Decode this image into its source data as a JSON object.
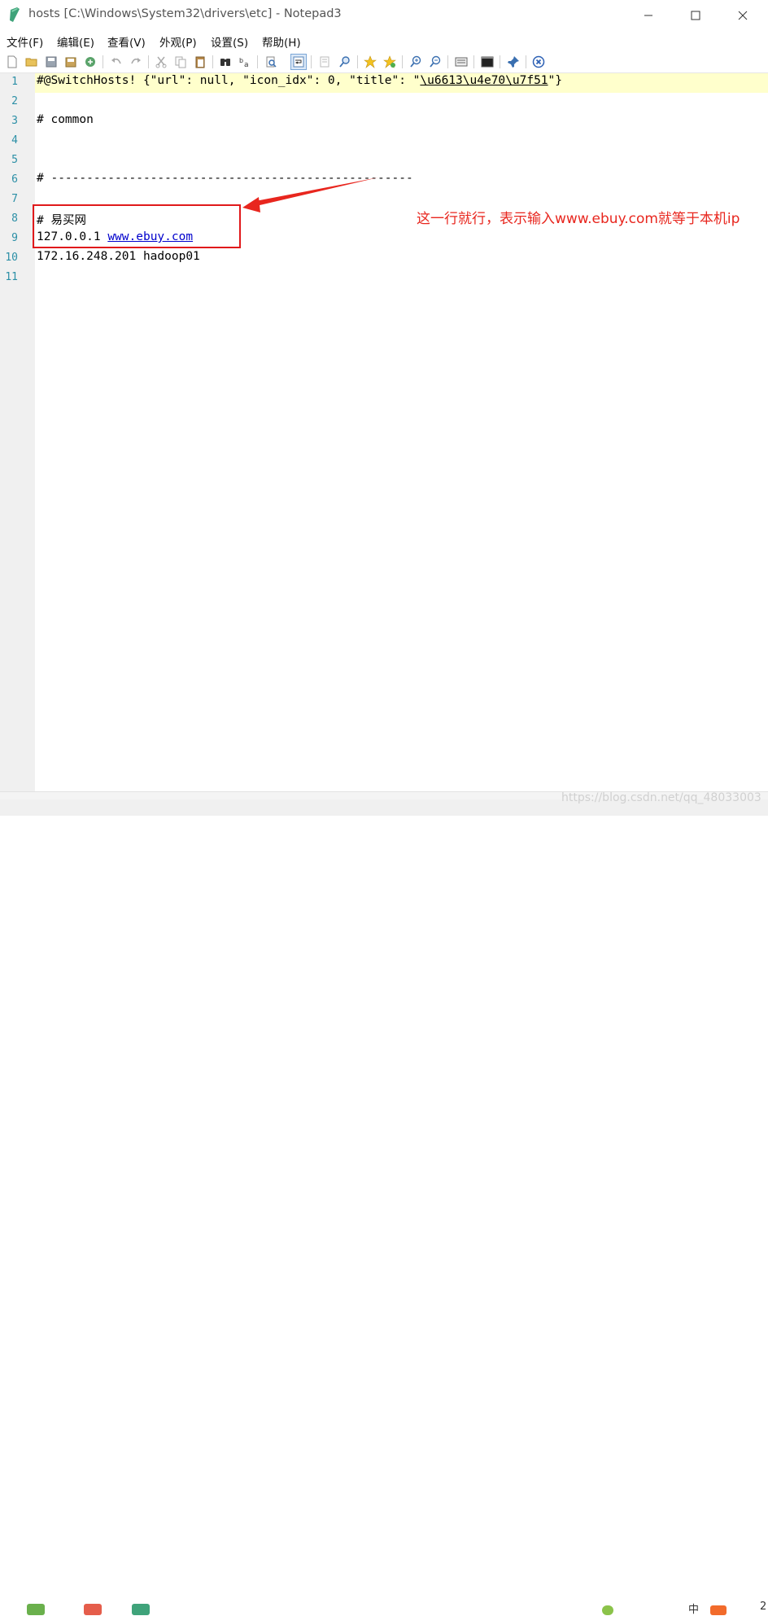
{
  "window": {
    "title": "hosts [C:\\Windows\\System32\\drivers\\etc] - Notepad3",
    "minimize": "—",
    "maximize": "☐",
    "close": "✕"
  },
  "menu": [
    "文件(F)",
    "编辑(E)",
    "查看(V)",
    "外观(P)",
    "设置(S)",
    "帮助(H)"
  ],
  "toolbar": [
    "new-file-icon",
    "open-folder-icon",
    "save-icon",
    "save-all-icon",
    "reload-icon",
    "undo-icon",
    "redo-icon",
    "cut-icon",
    "copy-icon",
    "paste-icon",
    "find-icon",
    "replace-icon",
    "find-next-icon",
    "word-wrap-icon",
    "line-numbers-icon",
    "zoom-find-icon",
    "favorites-icon",
    "add-favorite-icon",
    "zoom-in-icon",
    "zoom-out-icon",
    "schemes-icon",
    "terminal-icon",
    "pin-icon",
    "close-file-icon"
  ],
  "editor": {
    "line_numbers": [
      "1",
      "2",
      "3",
      "4",
      "5",
      "6",
      "7",
      "8",
      "9",
      "10",
      "11"
    ],
    "lines": {
      "l1_a": "#@SwitchHosts! {\"url\": null, \"icon_idx\": 0, \"title\": \"",
      "l1_b": "\\u6613\\u4e70\\u7f51",
      "l1_c": "\"}",
      "l3": "# common",
      "l6": "# ---------------------------------------------------",
      "l8_hash": "# ",
      "l8_cjk": "易买网",
      "l9_ip": "127.0.0.1 ",
      "l9_link": "www.ebuy.com",
      "l10": "172.16.248.201 hadoop01"
    }
  },
  "annotation": {
    "text": "这一行就行，表示输入www.ebuy.com就等于本机ip",
    "color": "#e8261e"
  },
  "footer": {
    "watermark": "https://blog.csdn.net/qq_48033003",
    "tray_text_1": "中",
    "tray_text_2": "2"
  }
}
